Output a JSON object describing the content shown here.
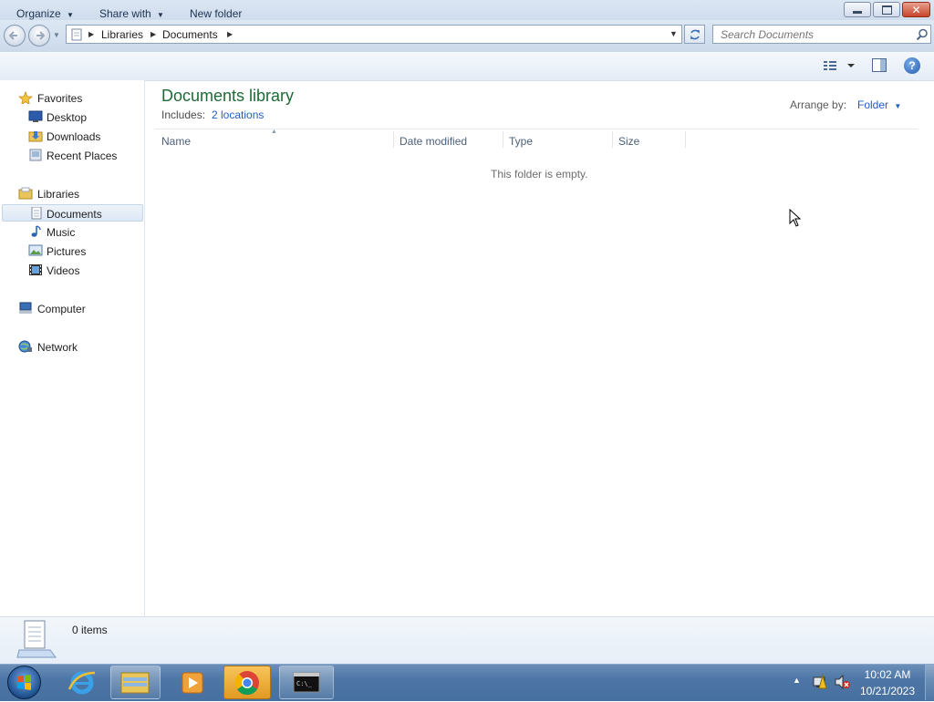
{
  "window": {
    "address": {
      "crumbs": [
        "Libraries",
        "Documents"
      ]
    },
    "search_placeholder": "Search Documents",
    "toolbar": {
      "organize": "Organize",
      "share_with": "Share with",
      "new_folder": "New folder"
    }
  },
  "nav_pane": {
    "favorites": {
      "label": "Favorites",
      "items": [
        "Desktop",
        "Downloads",
        "Recent Places"
      ]
    },
    "libraries": {
      "label": "Libraries",
      "items": [
        "Documents",
        "Music",
        "Pictures",
        "Videos"
      ],
      "selected": "Documents"
    },
    "computer": "Computer",
    "network": "Network"
  },
  "content": {
    "title": "Documents library",
    "includes_label": "Includes:",
    "includes_link": "2 locations",
    "arrange_label": "Arrange by:",
    "arrange_value": "Folder",
    "columns": [
      "Name",
      "Date modified",
      "Type",
      "Size"
    ],
    "empty_message": "This folder is empty."
  },
  "details_pane": {
    "item_count": "0 items"
  },
  "taskbar": {
    "pinned": [
      "start-orb",
      "internet-explorer-icon",
      "windows-explorer-icon",
      "media-player-icon",
      "chrome-icon",
      "command-prompt-icon"
    ],
    "clock_time": "10:02 AM",
    "clock_date": "10/21/2023"
  }
}
